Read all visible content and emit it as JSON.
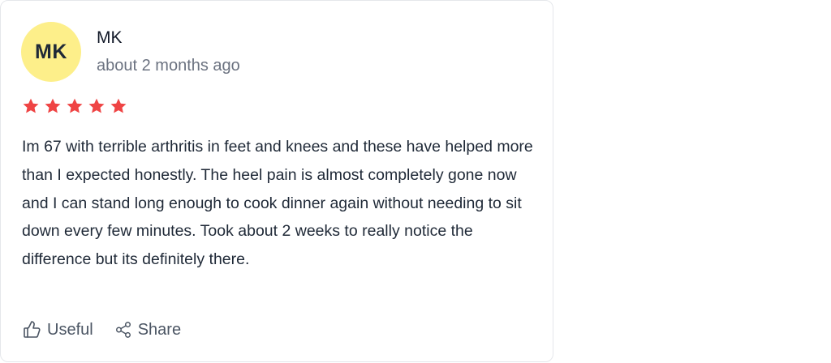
{
  "review": {
    "avatar": {
      "initials": "MK",
      "background": "#fdef8a"
    },
    "author": "MK",
    "timestamp": "about 2 months ago",
    "rating": {
      "value": 5,
      "max": 5,
      "color": "#ef4444"
    },
    "text": "Im 67 with terrible arthritis in feet and knees and these have helped more than I expected honestly. The heel pain is almost completely gone now and I can stand long enough to cook dinner again without needing to sit down every few minutes. Took about 2 weeks to really notice the difference but its definitely there.",
    "actions": {
      "useful": {
        "label": "Useful",
        "icon": "thumbs-up-icon"
      },
      "share": {
        "label": "Share",
        "icon": "share-icon"
      }
    }
  }
}
